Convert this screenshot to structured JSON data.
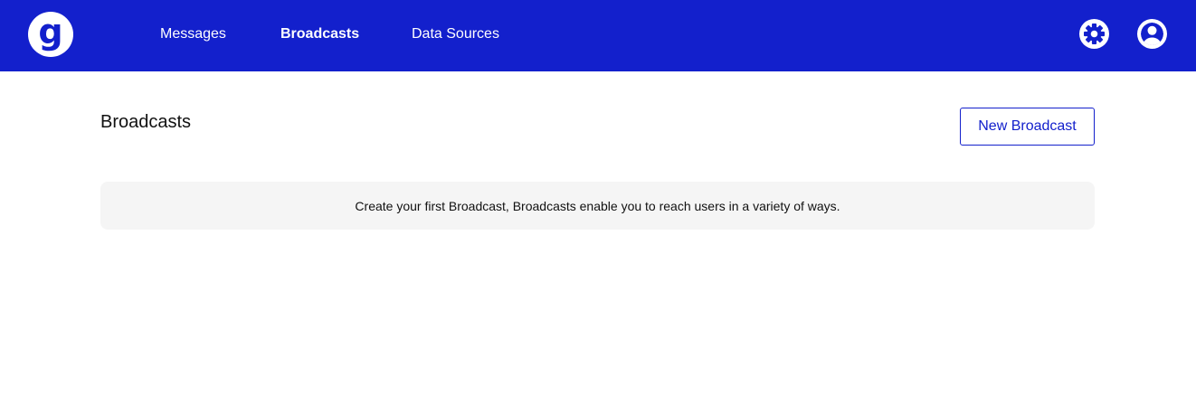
{
  "app": {
    "logo_letter": "g",
    "brand_color": "#1320cc"
  },
  "nav": {
    "items": [
      {
        "label": "Messages",
        "active": false
      },
      {
        "label": "Broadcasts",
        "active": true
      },
      {
        "label": "Data Sources",
        "active": false
      }
    ]
  },
  "header_icons": {
    "settings": "gear-icon",
    "account": "user-avatar-icon"
  },
  "page": {
    "title": "Broadcasts",
    "new_button_label": "New Broadcast",
    "empty_message": "Create your first Broadcast, Broadcasts enable you to reach users in a variety of ways."
  }
}
